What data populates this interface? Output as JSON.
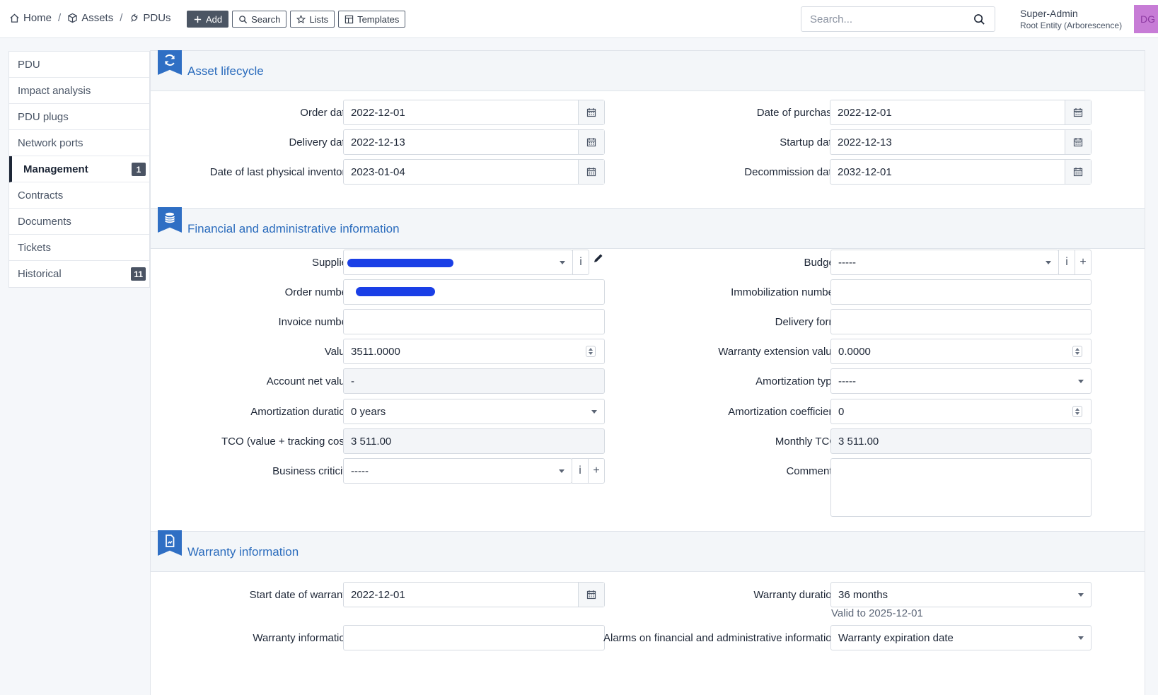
{
  "breadcrumb": {
    "home": "Home",
    "assets": "Assets",
    "pdus": "PDUs",
    "sep": "/"
  },
  "toolbar": {
    "add": "Add",
    "search": "Search",
    "lists": "Lists",
    "templates": "Templates"
  },
  "global_search": {
    "placeholder": "Search..."
  },
  "user": {
    "name": "Super-Admin",
    "entity": "Root Entity (Arborescence)",
    "initials": "DG"
  },
  "sidebar": {
    "items": [
      {
        "label": "PDU"
      },
      {
        "label": "Impact analysis"
      },
      {
        "label": "PDU plugs"
      },
      {
        "label": "Network ports"
      },
      {
        "label": "Management",
        "badge": "1",
        "active": true
      },
      {
        "label": "Contracts"
      },
      {
        "label": "Documents"
      },
      {
        "label": "Tickets"
      },
      {
        "label": "Historical",
        "badge": "11"
      }
    ]
  },
  "lifecycle": {
    "title": "Asset lifecycle",
    "order_date": {
      "label": "Order date",
      "value": "2022-12-01"
    },
    "delivery_date": {
      "label": "Delivery date",
      "value": "2022-12-13"
    },
    "inventory_date": {
      "label": "Date of last physical inventory",
      "value": "2023-01-04"
    },
    "purchase_date": {
      "label": "Date of purchase",
      "value": "2022-12-01"
    },
    "startup_date": {
      "label": "Startup date",
      "value": "2022-12-13"
    },
    "decommission_date": {
      "label": "Decommission date",
      "value": "2032-12-01"
    }
  },
  "financial": {
    "title": "Financial and administrative information",
    "supplier": {
      "label": "Supplier",
      "info": "i"
    },
    "order_number": {
      "label": "Order number"
    },
    "invoice_number": {
      "label": "Invoice number",
      "value": ""
    },
    "value": {
      "label": "Value",
      "value": "3511.0000"
    },
    "account_net_value": {
      "label": "Account net value",
      "value": "-"
    },
    "amortization_duration": {
      "label": "Amortization duration",
      "value": "0 years"
    },
    "tco": {
      "label": "TCO (value + tracking cost)",
      "value": "3 511.00"
    },
    "business_criticity": {
      "label": "Business criticity",
      "value": "-----",
      "info": "i",
      "add": "+"
    },
    "budget": {
      "label": "Budget",
      "value": "-----",
      "info": "i",
      "add": "+"
    },
    "immobilization_number": {
      "label": "Immobilization number",
      "value": ""
    },
    "delivery_form": {
      "label": "Delivery form",
      "value": ""
    },
    "warranty_extension_value": {
      "label": "Warranty extension value",
      "value": "0.0000"
    },
    "amortization_type": {
      "label": "Amortization type",
      "value": "-----"
    },
    "amortization_coefficient": {
      "label": "Amortization coefficient",
      "value": "0"
    },
    "monthly_tco": {
      "label": "Monthly TCO",
      "value": "3 511.00"
    },
    "comments": {
      "label": "Comments",
      "value": ""
    }
  },
  "warranty": {
    "title": "Warranty information",
    "start_date": {
      "label": "Start date of warranty",
      "value": "2022-12-01"
    },
    "info": {
      "label": "Warranty information",
      "value": ""
    },
    "duration": {
      "label": "Warranty duration",
      "value": "36 months",
      "valid_to": "Valid to 2025-12-01"
    },
    "alarms": {
      "label": "Alarms on financial and administrative information",
      "value": "Warranty expiration date"
    }
  },
  "colors": {
    "accent": "#2b6cbd",
    "ribbon": "#2f6fc4",
    "badge": "#4a5363",
    "avatar": "#c77cd6",
    "redaction": "#1a3fe6"
  }
}
